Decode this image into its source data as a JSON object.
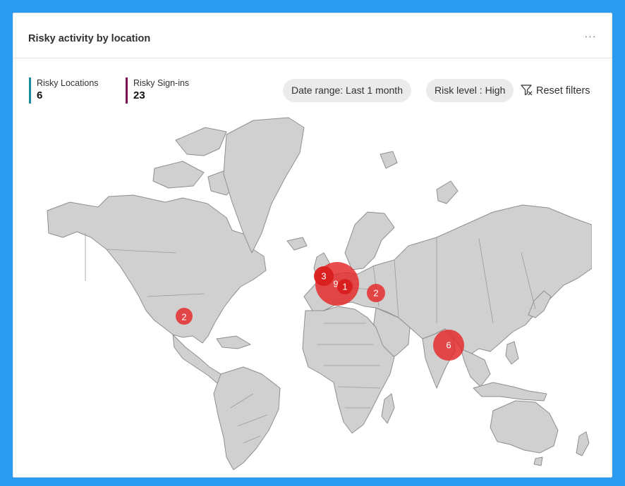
{
  "card": {
    "title": "Risky activity by location",
    "more_label": "···"
  },
  "metrics": [
    {
      "label": "Risky Locations",
      "value": "6",
      "color": "#1b8c9b"
    },
    {
      "label": "Risky Sign-ins",
      "value": "23",
      "color": "#7a1150"
    }
  ],
  "filters": {
    "date_range": "Date range: Last 1 month",
    "risk_level": "Risk level : High",
    "reset": "Reset filters",
    "reset_icon": "filter-clear-icon"
  },
  "map": {
    "land_color": "#d0d0d0",
    "bubble_color": "#e52d2d",
    "locations": [
      {
        "name": "United States",
        "count": "2"
      },
      {
        "name": "Western Europe",
        "count": "9"
      },
      {
        "name": "United Kingdom",
        "count": "3"
      },
      {
        "name": "Central Europe",
        "count": "1"
      },
      {
        "name": "Eastern Europe",
        "count": "2"
      },
      {
        "name": "India",
        "count": "6"
      }
    ]
  }
}
